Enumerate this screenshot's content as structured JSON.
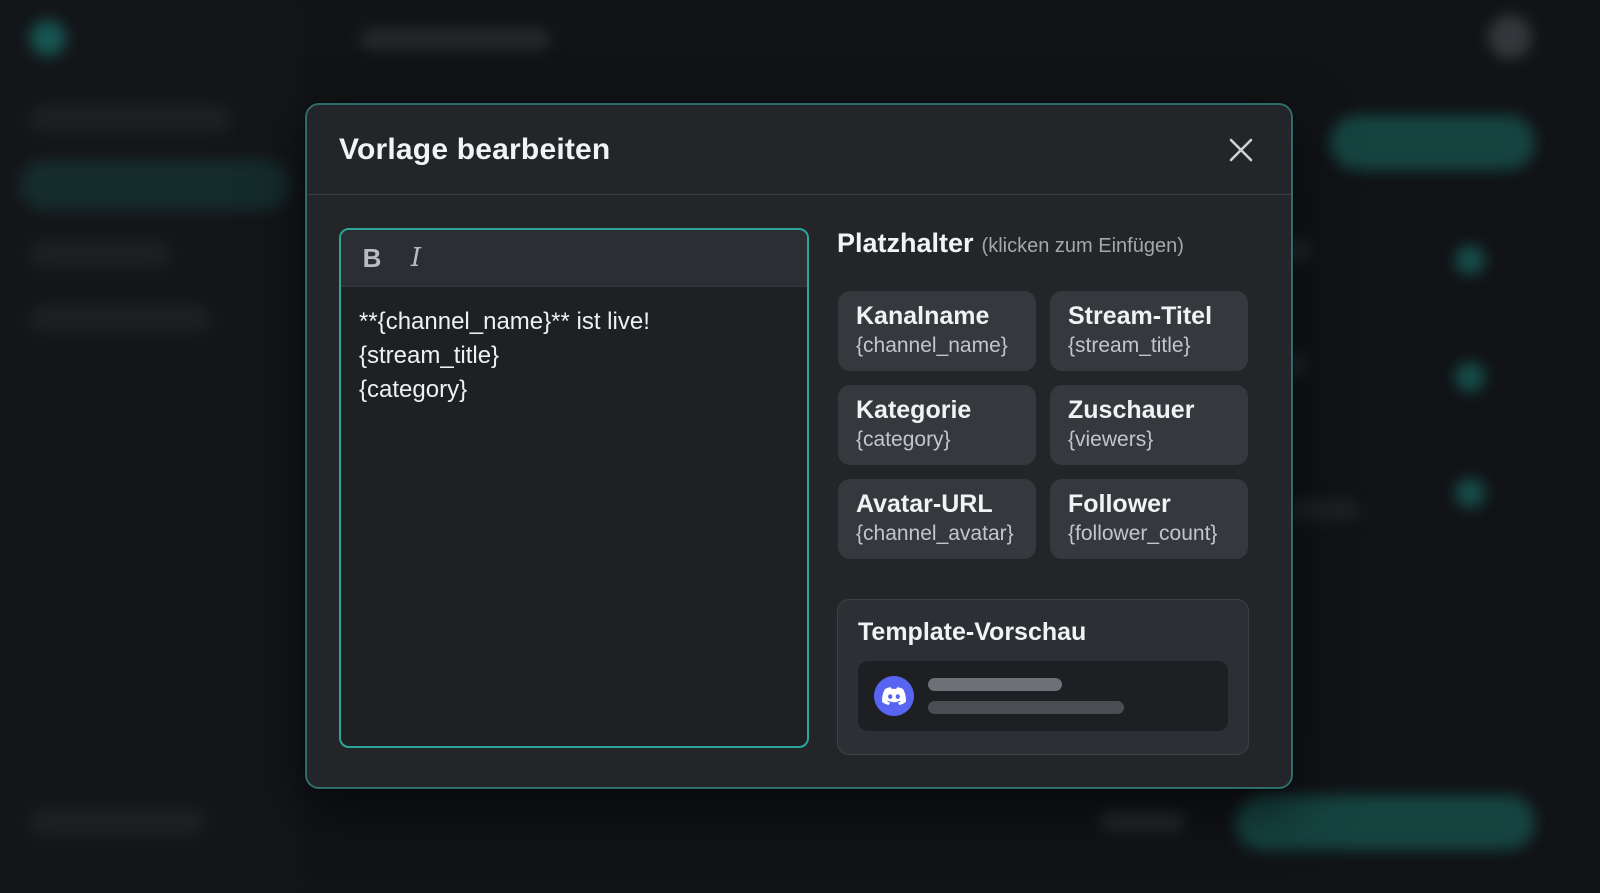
{
  "modal": {
    "title": "Vorlage bearbeiten"
  },
  "editor": {
    "toolbar": {
      "bold_label": "B",
      "italic_label": "I"
    },
    "lines": [
      "**{channel_name}** ist live!",
      "{stream_title}",
      "{category}"
    ]
  },
  "placeholders": {
    "title": "Platzhalter",
    "hint": "(klicken zum Einfügen)",
    "items": [
      {
        "label": "Kanalname",
        "token": "{channel_name}"
      },
      {
        "label": "Stream-Titel",
        "token": "{stream_title}"
      },
      {
        "label": "Kategorie",
        "token": "{category}"
      },
      {
        "label": "Zuschauer",
        "token": "{viewers}"
      },
      {
        "label": "Avatar-URL",
        "token": "{channel_avatar}"
      },
      {
        "label": "Follower",
        "token": "{follower_count}"
      }
    ]
  },
  "preview": {
    "title": "Template-Vorschau",
    "avatar_icon": "discord-icon"
  },
  "colors": {
    "accent": "#2aa69b",
    "discord": "#5865f2",
    "background": "#16181b",
    "modal": "#232528"
  }
}
